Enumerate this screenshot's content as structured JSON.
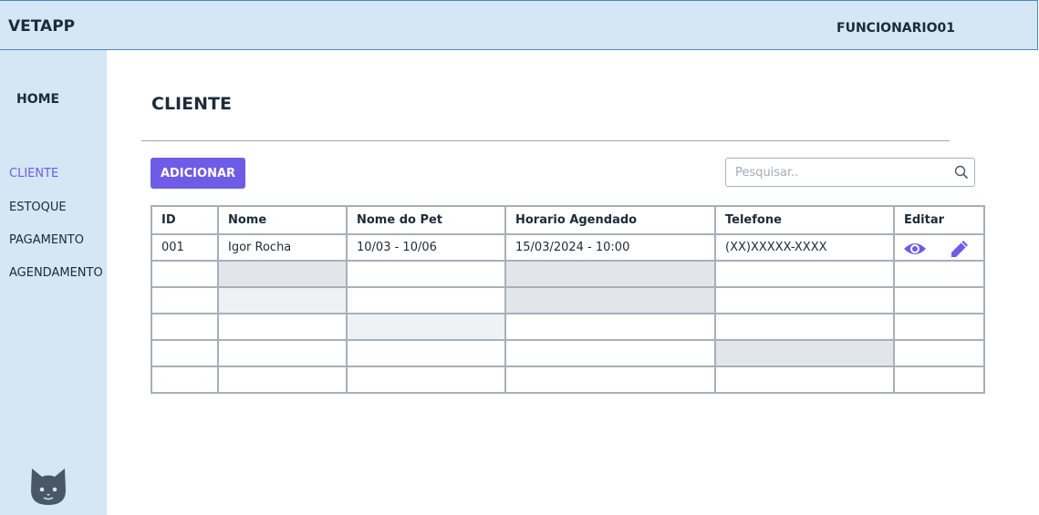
{
  "header": {
    "brand": "VETAPP",
    "user": "FUNCIONARIO01"
  },
  "sidebar": {
    "home": "HOME",
    "items": [
      {
        "label": "CLIENTE",
        "active": true
      },
      {
        "label": "ESTOQUE",
        "active": false
      },
      {
        "label": "PAGAMENTO",
        "active": false
      },
      {
        "label": "AGENDAMENTO",
        "active": false
      }
    ],
    "logo_icon": "cat-icon"
  },
  "main": {
    "title": "CLIENTE",
    "add_label": "ADICIONAR",
    "search": {
      "placeholder": "Pesquisar..",
      "value": "",
      "icon": "search-icon"
    },
    "table": {
      "columns": [
        "ID",
        "Nome",
        "Nome do Pet",
        "Horario Agendado",
        "Telefone",
        "Editar"
      ],
      "rows": [
        [
          "001",
          "Igor Rocha",
          "10/03 - 10/06",
          "15/03/2024 - 10:00",
          "(XX)XXXXX-XXXX",
          ""
        ],
        [
          "",
          "",
          "",
          "",
          "",
          ""
        ],
        [
          "",
          "",
          "",
          "",
          "",
          ""
        ],
        [
          "",
          "",
          "",
          "",
          "",
          ""
        ],
        [
          "",
          "",
          "",
          "",
          "",
          ""
        ],
        [
          "",
          "",
          "",
          "",
          "",
          ""
        ]
      ],
      "action_icons": [
        "eye-icon",
        "pencil-icon"
      ]
    }
  },
  "colors": {
    "accent": "#6e5ce6",
    "sidebar_bg": "#d5e6f5",
    "header_border": "#4a86c8",
    "icon_dark": "#4a5866"
  }
}
